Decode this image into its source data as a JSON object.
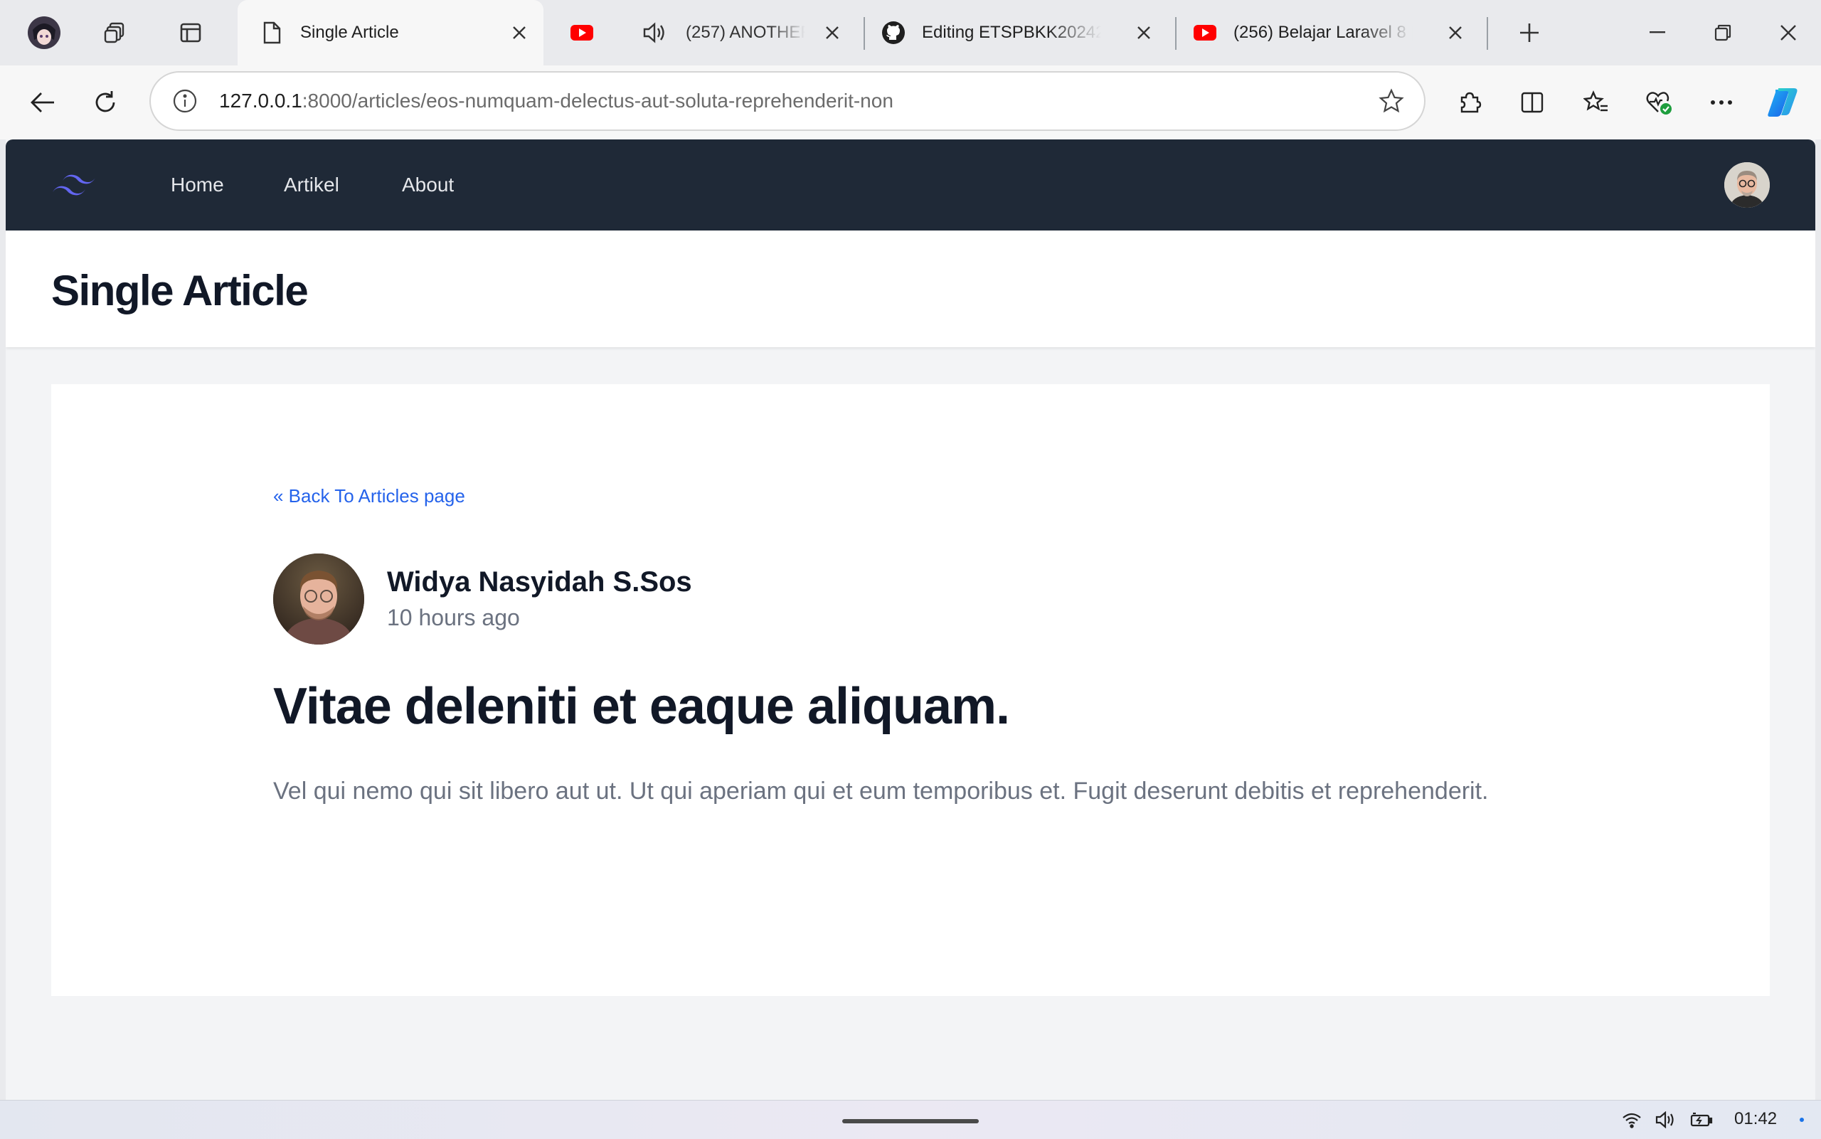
{
  "browser": {
    "tabs": [
      {
        "title": "Single Article",
        "favicon": "page-icon",
        "active": true
      },
      {
        "title": "(257) ANOTHER",
        "favicon": "youtube-icon",
        "audio": true
      },
      {
        "title": "Editing ETSPBKK202420",
        "favicon": "github-icon"
      },
      {
        "title": "(256) Belajar Laravel 8 |",
        "favicon": "youtube-icon"
      }
    ],
    "address": {
      "host": "127.0.0.1",
      "rest": ":8000/articles/eos-numquam-delectus-aut-soluta-reprehenderit-non"
    }
  },
  "nav": {
    "links": [
      "Home",
      "Artikel",
      "About"
    ]
  },
  "header": {
    "title": "Single Article"
  },
  "article": {
    "back_link": "« Back To Articles page",
    "author": "Widya Nasyidah S.Sos",
    "time": "10 hours ago",
    "title": "Vitae deleniti et eaque aliquam.",
    "body": "Vel qui nemo qui sit libero aut ut. Ut qui aperiam qui et eum temporibus et. Fugit deserunt debitis et reprehenderit."
  },
  "taskbar": {
    "clock": "01:42"
  },
  "colors": {
    "navbar_bg": "#1f2937",
    "link_blue": "#2563eb",
    "logo_indigo": "#6366f1"
  }
}
